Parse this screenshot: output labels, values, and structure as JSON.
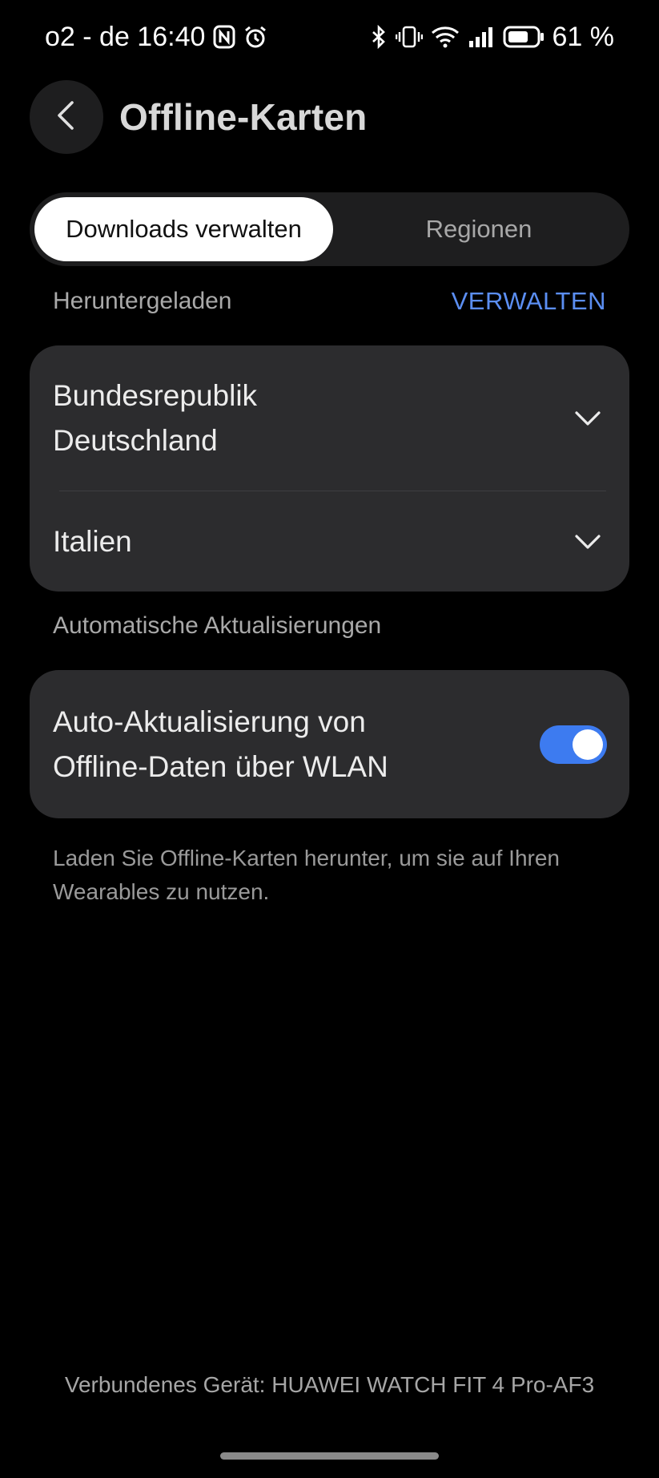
{
  "status_bar": {
    "carrier_time": "o2 - de 16:40",
    "battery": "61 %",
    "icons": [
      "nfc-icon",
      "alarm-icon",
      "bluetooth-icon",
      "vibrate-icon",
      "wifi-icon",
      "signal-icon",
      "battery-icon"
    ]
  },
  "header": {
    "back_icon": "chevron-left-icon",
    "title": "Offline-Karten"
  },
  "tabs": [
    {
      "label": "Downloads verwalten",
      "selected": true
    },
    {
      "label": "Regionen",
      "selected": false
    }
  ],
  "downloaded": {
    "section_title": "Heruntergeladen",
    "action_label": "VERWALTEN",
    "regions": [
      {
        "name_line1": "Bundesrepublik",
        "name_line2": "Deutschland"
      },
      {
        "name_line1": "Italien"
      }
    ]
  },
  "auto_updates": {
    "section_title": "Automatische Aktualisierungen",
    "toggle_label_line1": "Auto-Aktualisierung von",
    "toggle_label_line2": "Offline-Daten über WLAN",
    "enabled": true
  },
  "helper_text": "Laden Sie Offline-Karten herunter, um sie auf Ihren Wearables zu nutzen.",
  "footer_text": "Verbundenes Gerät: HUAWEI WATCH FIT 4 Pro-AF3",
  "colors": {
    "background": "#000000",
    "card": "#2C2C2E",
    "accent": "#5B8EF2",
    "toggle_on": "#3D7BF0"
  }
}
